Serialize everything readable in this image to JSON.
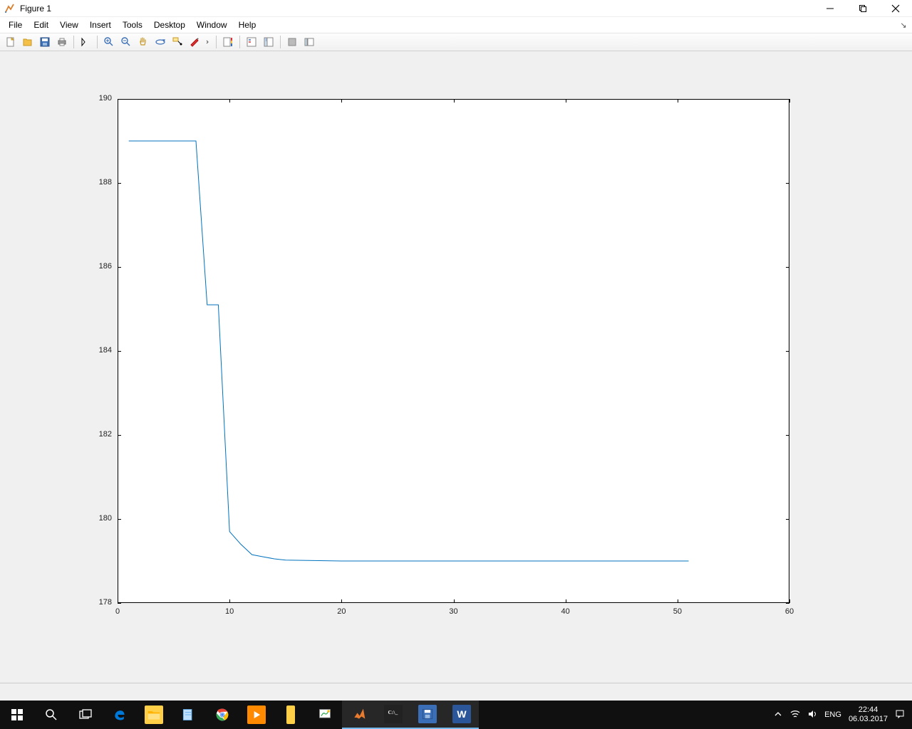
{
  "window": {
    "title": "Figure 1"
  },
  "menus": [
    "File",
    "Edit",
    "View",
    "Insert",
    "Tools",
    "Desktop",
    "Window",
    "Help"
  ],
  "tray": {
    "lang": "ENG",
    "time": "22:44",
    "date": "06.03.2017"
  },
  "chart_data": {
    "type": "line",
    "x": [
      1,
      2,
      3,
      4,
      5,
      6,
      7,
      8,
      9,
      10,
      11,
      12,
      13,
      14,
      15,
      20,
      25,
      30,
      35,
      40,
      45,
      50,
      51
    ],
    "y": [
      189,
      189,
      189,
      189,
      189,
      189,
      189,
      185.1,
      185.1,
      179.7,
      179.4,
      179.15,
      179.1,
      179.05,
      179.02,
      179,
      179,
      179,
      179,
      179,
      179,
      179,
      179
    ],
    "xlabel": "",
    "ylabel": "",
    "title": "",
    "xlim": [
      0,
      60
    ],
    "ylim": [
      178,
      190
    ],
    "xticks": [
      0,
      10,
      20,
      30,
      40,
      50,
      60
    ],
    "yticks": [
      178,
      180,
      182,
      184,
      186,
      188,
      190
    ],
    "line_color": "#0072BD"
  }
}
